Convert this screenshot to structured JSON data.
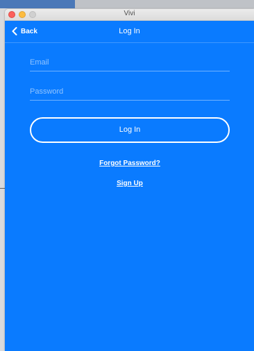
{
  "window": {
    "title": "Vivi"
  },
  "navbar": {
    "back_label": "Back",
    "title": "Log In"
  },
  "form": {
    "email_placeholder": "Email",
    "email_value": "",
    "password_placeholder": "Password",
    "password_value": "",
    "login_label": "Log In"
  },
  "links": {
    "forgot_password": "Forgot Password?",
    "sign_up": "Sign Up"
  },
  "colors": {
    "app_background": "#0a7bff",
    "text": "#ffffff"
  },
  "icons": {
    "back": "chevron-left-icon"
  }
}
